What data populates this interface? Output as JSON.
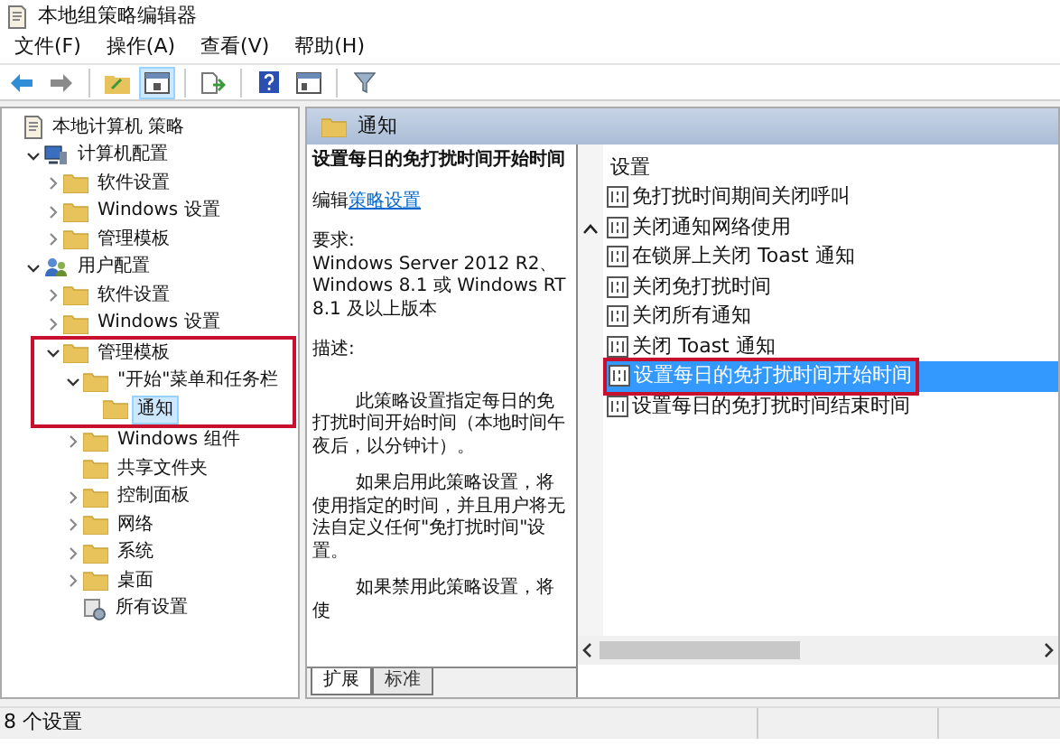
{
  "window": {
    "title": "本地组策略编辑器"
  },
  "menu": [
    "文件(F)",
    "操作(A)",
    "查看(V)",
    "帮助(H)"
  ],
  "toolbar": [
    {
      "kind": "back"
    },
    {
      "kind": "forward"
    },
    {
      "kind": "sep"
    },
    {
      "kind": "folder-up"
    },
    {
      "kind": "pane",
      "selected": true
    },
    {
      "kind": "sep"
    },
    {
      "kind": "export"
    },
    {
      "kind": "sep"
    },
    {
      "kind": "help"
    },
    {
      "kind": "pane2"
    },
    {
      "kind": "sep"
    },
    {
      "kind": "filter"
    }
  ],
  "tree": [
    {
      "label": "本地计算机 策略",
      "kind": "policy",
      "selected": false,
      "children": [
        {
          "label": "计算机配置",
          "kind": "computer",
          "selected": false,
          "expanded": true,
          "children": [
            {
              "label": "软件设置",
              "kind": "folder",
              "selected": false,
              "expanded": false
            },
            {
              "label": "Windows 设置",
              "kind": "folder",
              "selected": false,
              "expanded": false
            },
            {
              "label": "管理模板",
              "kind": "folder",
              "selected": false,
              "expanded": false
            }
          ]
        },
        {
          "label": "用户配置",
          "kind": "user",
          "selected": false,
          "expanded": true,
          "children": [
            {
              "label": "软件设置",
              "kind": "folder",
              "selected": false,
              "expanded": false
            },
            {
              "label": "Windows 设置",
              "kind": "folder",
              "selected": false,
              "expanded": false
            },
            {
              "label": "管理模板",
              "kind": "folder",
              "selected": false,
              "expanded": true,
              "annotated": true,
              "children": [
                {
                  "label": "\"开始\"菜单和任务栏",
                  "kind": "folder",
                  "selected": false,
                  "expanded": true,
                  "children": [
                    {
                      "label": "通知",
                      "kind": "folder",
                      "selected": true
                    }
                  ]
                },
                {
                  "label": "Windows 组件",
                  "kind": "folder",
                  "selected": false,
                  "expanded": false
                },
                {
                  "label": "共享文件夹",
                  "kind": "folder",
                  "selected": false
                },
                {
                  "label": "控制面板",
                  "kind": "folder",
                  "selected": false,
                  "expanded": false
                },
                {
                  "label": "网络",
                  "kind": "folder",
                  "selected": false,
                  "expanded": false
                },
                {
                  "label": "系统",
                  "kind": "folder",
                  "selected": false,
                  "expanded": false
                },
                {
                  "label": "桌面",
                  "kind": "folder",
                  "selected": false,
                  "expanded": false
                },
                {
                  "label": "所有设置",
                  "kind": "settings",
                  "selected": false
                }
              ]
            }
          ]
        }
      ]
    }
  ],
  "header": {
    "title": "通知"
  },
  "detail": {
    "title": "设置每日的免打扰时间开始时间",
    "edit_prefix": "编辑",
    "edit_link": "策略设置",
    "requirements_label": "要求:",
    "requirements": "Windows Server 2012 R2、Windows 8.1 或 Windows RT 8.1 及以上版本",
    "description_label": "描述:",
    "paragraphs": [
      "此策略设置指定每日的免打扰时间开始时间（本地时间午夜后，以分钟计）。",
      "如果启用此策略设置，将使用指定的时间，并且用户将无法自定义任何\"免打扰时间\"设置。",
      "如果禁用此策略设置，将使"
    ]
  },
  "list": {
    "column": "设置",
    "items": [
      {
        "label": "免打扰时间期间关闭呼叫",
        "selected": false
      },
      {
        "label": "关闭通知网络使用",
        "selected": false
      },
      {
        "label": "在锁屏上关闭 Toast 通知",
        "selected": false
      },
      {
        "label": "关闭免打扰时间",
        "selected": false
      },
      {
        "label": "关闭所有通知",
        "selected": false
      },
      {
        "label": "关闭 Toast 通知",
        "selected": false
      },
      {
        "label": "设置每日的免打扰时间开始时间",
        "selected": true,
        "annotated": true
      },
      {
        "label": "设置每日的免打扰时间结束时间",
        "selected": false
      }
    ]
  },
  "tabs": [
    {
      "label": "扩展",
      "selected": true
    },
    {
      "label": "标准",
      "selected": false
    }
  ],
  "status_bar": {
    "text": "8 个设置"
  }
}
